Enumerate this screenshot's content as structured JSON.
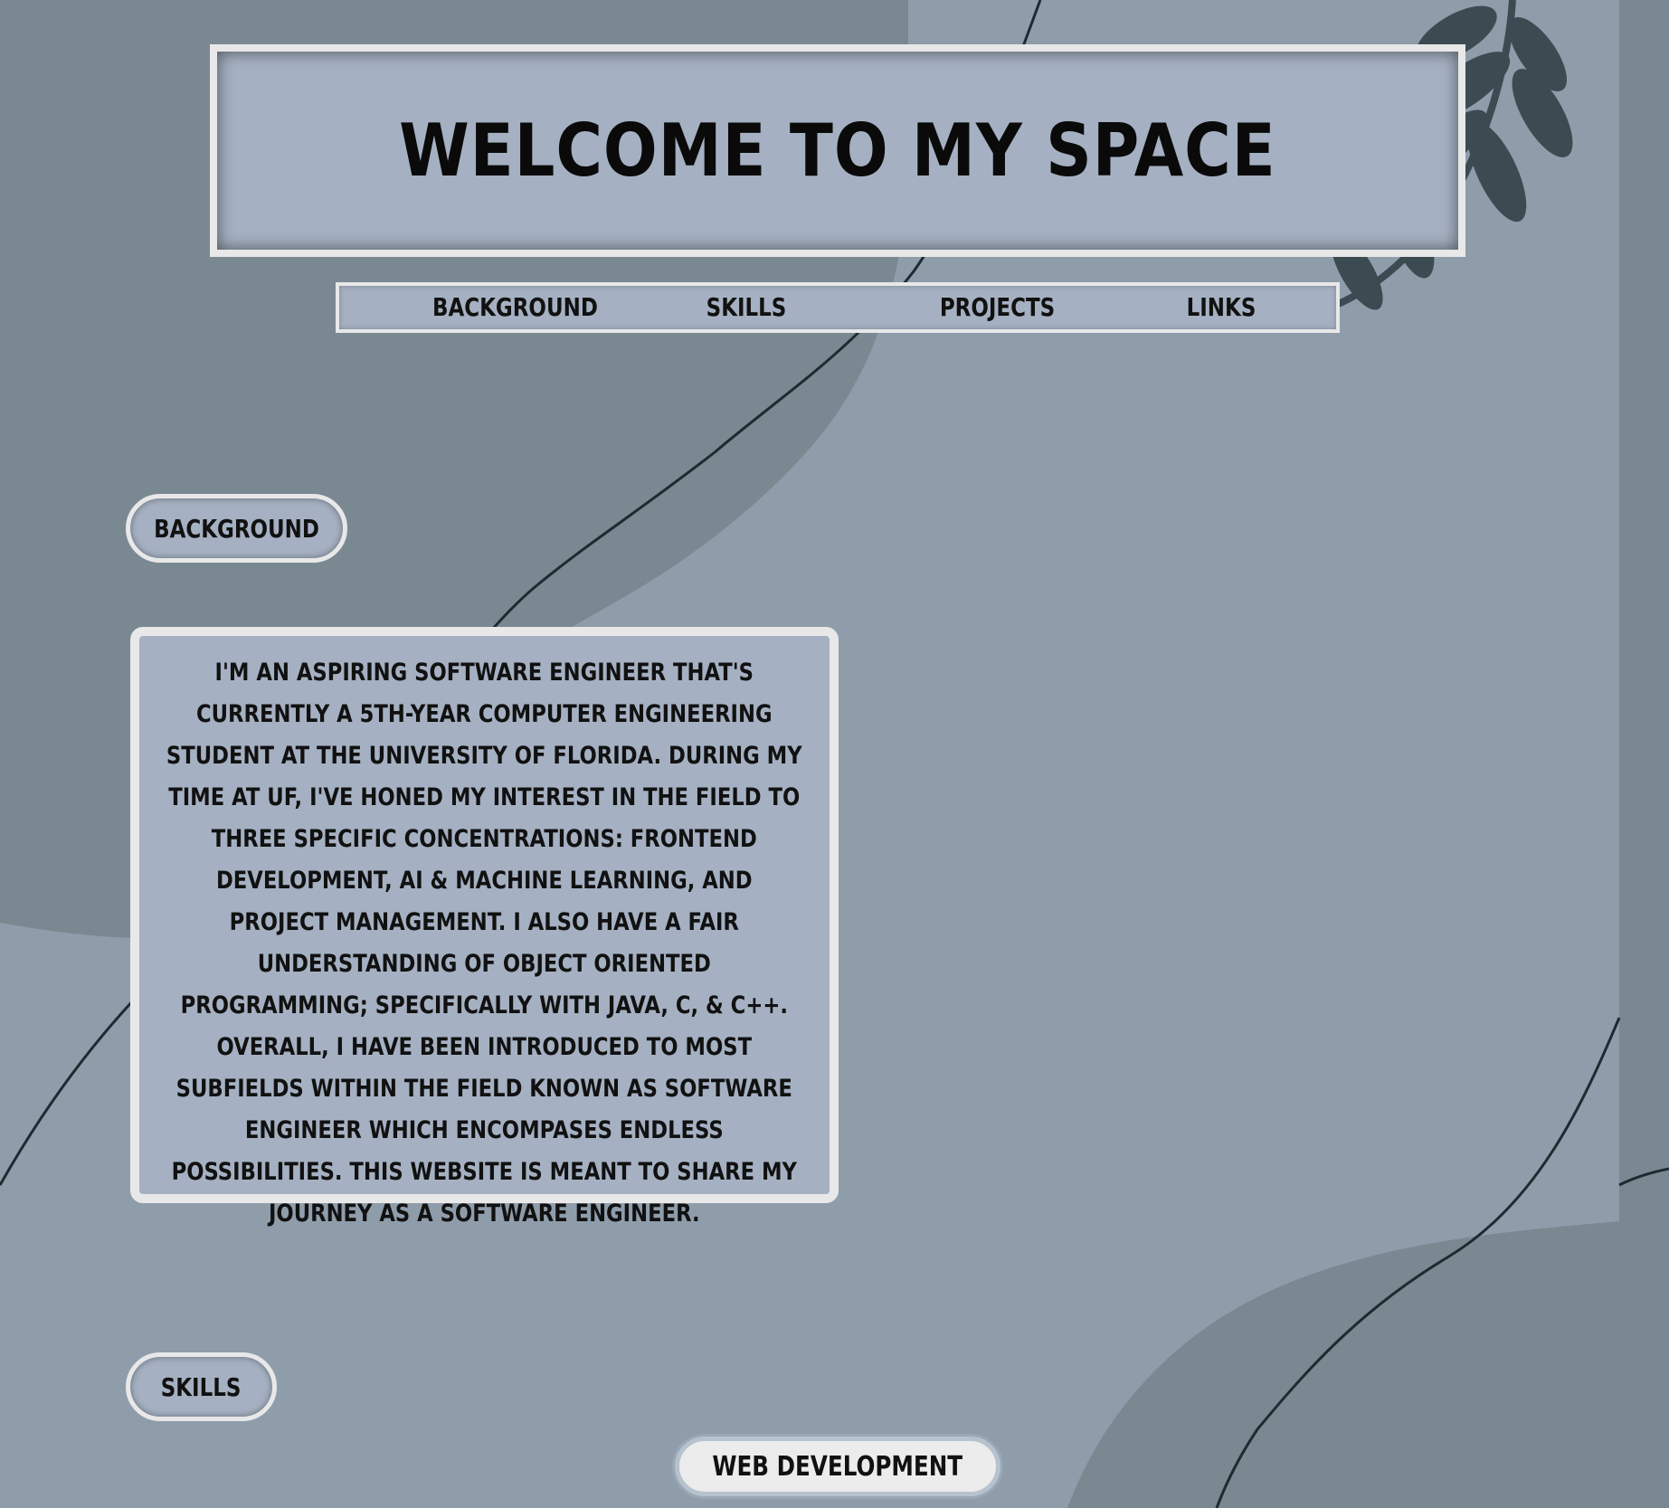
{
  "header": {
    "title": "WELCOME TO MY SPACE"
  },
  "nav": {
    "items": [
      {
        "label": "BACKGROUND"
      },
      {
        "label": "SKILLS"
      },
      {
        "label": "PROJECTS"
      },
      {
        "label": "LINKS"
      }
    ]
  },
  "sections": {
    "background": {
      "heading": "BACKGROUND",
      "text": "I'M AN ASPIRING SOFTWARE ENGINEER THAT'S CURRENTLY A 5TH-YEAR COMPUTER ENGINEERING STUDENT AT THE UNIVERSITY OF FLORIDA. DURING MY TIME AT UF, I'VE HONED MY INTEREST IN THE FIELD TO THREE SPECIFIC CONCENTRATIONS: FRONTEND DEVELOPMENT, AI & MACHINE LEARNING, AND PROJECT MANAGEMENT. I ALSO HAVE A FAIR UNDERSTANDING OF OBJECT ORIENTED PROGRAMMING; SPECIFICALLY WITH JAVA, C, & C++. OVERALL, I HAVE BEEN INTRODUCED TO MOST SUBFIELDS WITHIN THE FIELD KNOWN AS SOFTWARE ENGINEER WHICH ENCOMPASES ENDLESS POSSIBILITIES. THIS WEBSITE IS MEANT TO SHARE MY JOURNEY AS A SOFTWARE ENGINEER."
    },
    "skills": {
      "heading": "SKILLS",
      "first_item": "WEB DEVELOPMENT"
    }
  },
  "colors": {
    "page_background": "#8f9dab",
    "panel_background": "#a5b1c2",
    "panel_border": "#e8e8e8",
    "dark_shape": "#7a8892",
    "leaf": "#3c4a52",
    "text": "#111111"
  }
}
